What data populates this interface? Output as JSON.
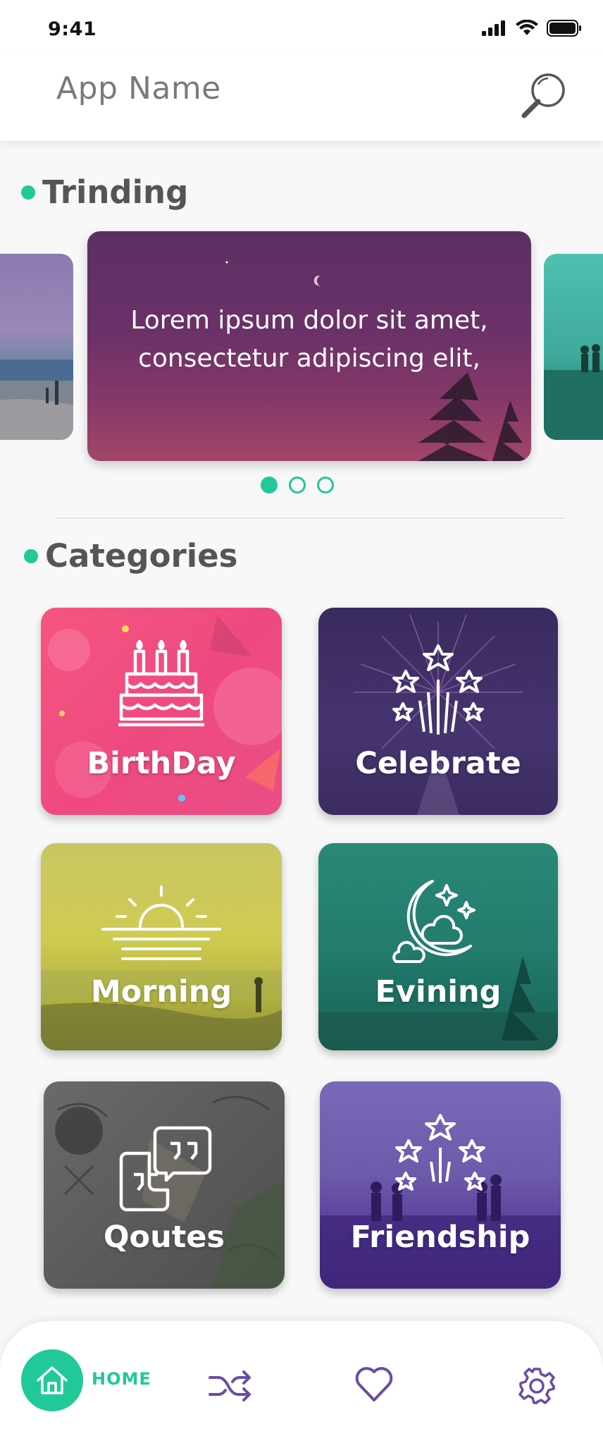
{
  "status_bar": {
    "time": "9:41"
  },
  "header": {
    "app_name": "App Name"
  },
  "trending": {
    "title": "Trinding",
    "main_card_text_line1": "Lorem ipsum dolor sit amet,",
    "main_card_text_line2": "consectetur adipiscing elit,",
    "pages": 3,
    "active_page": 1
  },
  "categories": {
    "title": "Categories",
    "items": [
      {
        "label": "BirthDay",
        "icon": "birthday-cake-icon"
      },
      {
        "label": "Celebrate",
        "icon": "fireworks-icon"
      },
      {
        "label": "Morning",
        "icon": "sunrise-icon"
      },
      {
        "label": "Evining",
        "icon": "moon-cloud-icon"
      },
      {
        "label": "Qoutes",
        "icon": "quote-bubbles-icon"
      },
      {
        "label": "Friendship",
        "icon": "stars-icon"
      }
    ]
  },
  "bottom_nav": {
    "home_label": "HOME",
    "items": [
      "home-icon",
      "shuffle-icon",
      "heart-icon",
      "settings-icon"
    ]
  },
  "colors": {
    "accent": "#20c997",
    "nav_icon": "#6a4ca3",
    "birthday": "#f0507f",
    "celebrate": "#3d2d63",
    "morning": "#c9c84a",
    "evening": "#1e7a6c",
    "quotes": "#5b5b5b",
    "friendship": "#5a3d9a"
  }
}
